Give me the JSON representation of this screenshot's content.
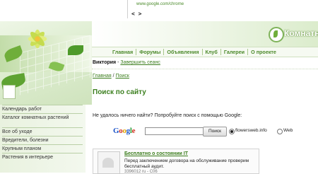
{
  "top": {
    "url": "www.google.com/chrome",
    "code": "< >"
  },
  "brand": {
    "name": "Комнатны"
  },
  "nav": {
    "items": [
      "Главная",
      "Форумы",
      "Объявления",
      "Клуб",
      "Галереи",
      "О проекте"
    ]
  },
  "user": {
    "name": "Виктория",
    "separator": " - ",
    "logout": "Завершить сеанс"
  },
  "breadcrumb": {
    "home": "Главная",
    "sep": " / ",
    "current": "Поиск"
  },
  "page": {
    "title": "Поиск по сайту"
  },
  "sidebar": {
    "items": [
      "Календарь работ",
      "Каталог комнатных растений",
      "Все об уходе",
      "Вредители, болезни",
      "Крупным планом",
      "Растения в интерьере"
    ]
  },
  "search": {
    "message": "Не удалось ничего найти? Попробуйте поиск с помощью Google:",
    "logo": {
      "g1": "G",
      "o1": "o",
      "o2": "o",
      "g2": "g",
      "l": "l",
      "e": "e"
    },
    "input_value": "",
    "button_label": "Поиск",
    "option_site": "flowersweb.info",
    "option_web": "Web",
    "selected": "flowersweb.info"
  },
  "ad": {
    "title": "Бесплатно о состоянии IT",
    "description": "Перед заключением договора на обслуживание проверим бесплатный аудит.",
    "meta": "3396012 ru - C06"
  },
  "colors": {
    "accent_green": "#3d8020",
    "link_green": "#3b7d1c",
    "nav_green": "#4d8a2c"
  }
}
